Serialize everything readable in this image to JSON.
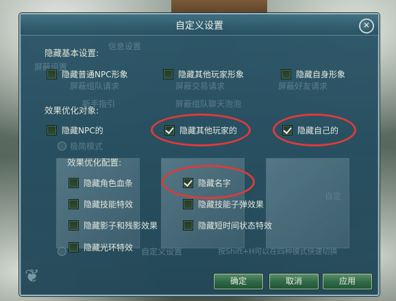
{
  "dialog": {
    "title": "自定义设置"
  },
  "sections": {
    "basic": "隐藏基本设置:",
    "effects": "效果优化对象:",
    "config": "效果优化配置:"
  },
  "basic_items": [
    {
      "label": "隐藏普通NPC形象",
      "checked": false
    },
    {
      "label": "隐藏其他玩家形象",
      "checked": false
    },
    {
      "label": "隐藏自身形象",
      "checked": false
    }
  ],
  "effect_items": [
    {
      "label": "隐藏NPC的",
      "checked": false
    },
    {
      "label": "隐藏其他玩家的",
      "checked": true
    },
    {
      "label": "隐藏自己的",
      "checked": true
    }
  ],
  "config_items": [
    {
      "label": "隐藏角色血条",
      "checked": false
    },
    {
      "label": "隐藏名字",
      "checked": true
    },
    {
      "label": "隐藏技能特效",
      "checked": false
    },
    {
      "label": "隐藏技能子弹效果",
      "checked": false
    },
    {
      "label": "隐藏影子和残影效果",
      "checked": false
    },
    {
      "label": "隐藏短时间状态特效",
      "checked": false
    },
    {
      "label": "隐藏光环特效",
      "checked": false
    }
  ],
  "background_ghost": {
    "texts": [
      "屏蔽组队请求",
      "屏蔽交易请求",
      "屏蔽好友请求",
      "屏蔽组队聊天泡泡",
      "新手指引",
      "极简模式",
      "自定义设置",
      "按Shift+H可以在四种模式快速切换",
      "自定"
    ],
    "partial": [
      "信息设置",
      "屏蔽设置"
    ]
  },
  "buttons": {
    "ok": "确定",
    "cancel": "取消",
    "apply": "应用"
  },
  "colors": {
    "highlight": "#e23a3a",
    "accent": "#2f6a46"
  }
}
